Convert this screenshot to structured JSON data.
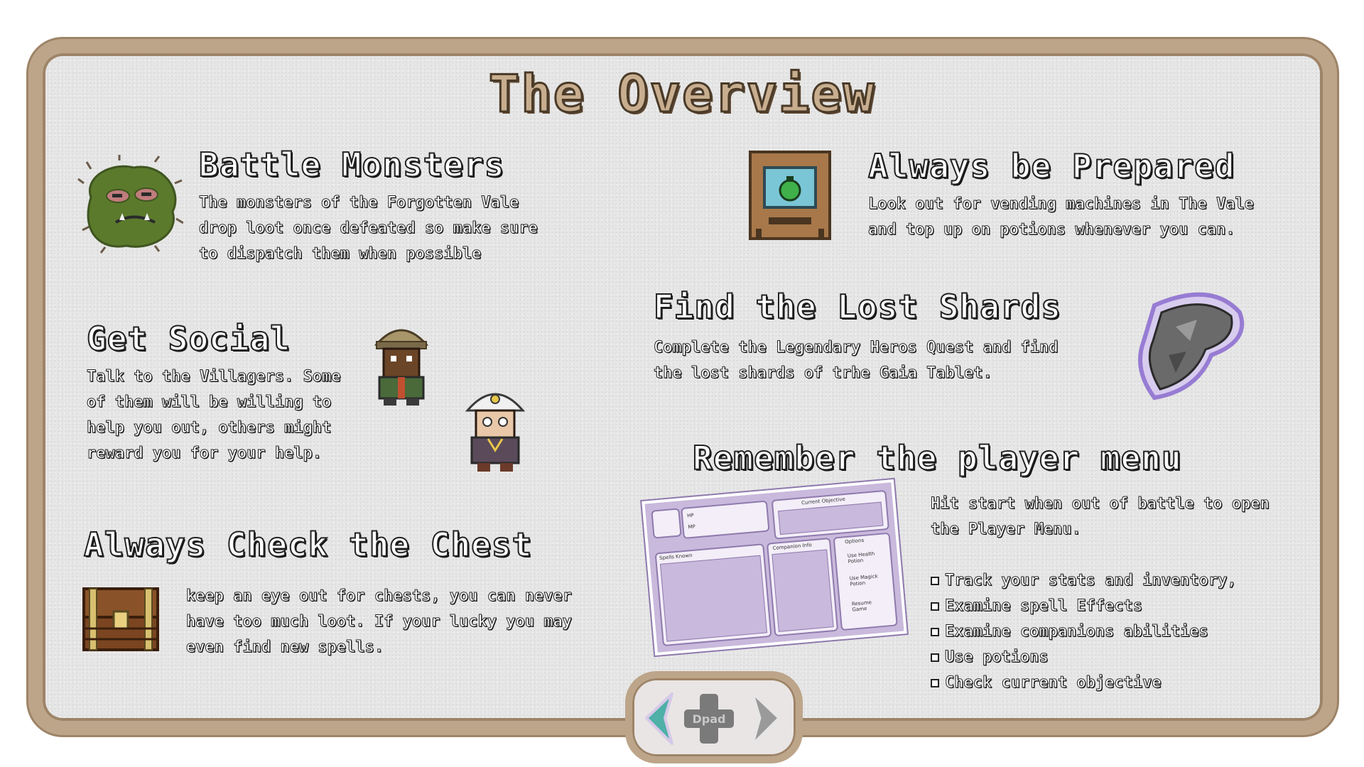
{
  "title": "The Overview",
  "sections": {
    "battle": {
      "heading": "Battle Monsters",
      "body": "The monsters of the Forgotten Vale\ndrop loot once defeated so make sure\nto dispatch them when possible"
    },
    "prepared": {
      "heading": "Always be Prepared",
      "body": "Look out for vending machines in The Vale\nand top up on potions whenever you can."
    },
    "social": {
      "heading": "Get Social",
      "body": "Talk to the Villagers. Some\nof them will be willing to\nhelp you out, others might\nreward you for your help."
    },
    "shards": {
      "heading": "Find the Lost Shards",
      "body": "Complete the Legendary Heros Quest and find\nthe lost shards of trhe Gaia Tablet."
    },
    "chest": {
      "heading": "Always Check the Chest",
      "body": "keep an eye out for chests, you can never\nhave too much loot. If your lucky you may\neven find new spells."
    },
    "menu": {
      "heading": "Remember the player menu",
      "body": "Hit start when out of battle to open\nthe Player Menu.",
      "bullets": [
        "Track your stats and inventory,",
        "Examine spell Effects",
        "Examine companions abilities",
        "Use potions",
        "Check current objective"
      ],
      "mockup": {
        "current_objective": "Current Objective",
        "spells_known": "Spells Known",
        "companion_info": "Companion Info",
        "options": "Options",
        "option_items": [
          "Use Health Potion",
          "Use Magick Potion",
          "Resume Game"
        ],
        "hp": "HP",
        "mp": "MP"
      }
    }
  },
  "nav": {
    "dpad_label": "Dpad",
    "accent_color": "#4fb0a8"
  }
}
